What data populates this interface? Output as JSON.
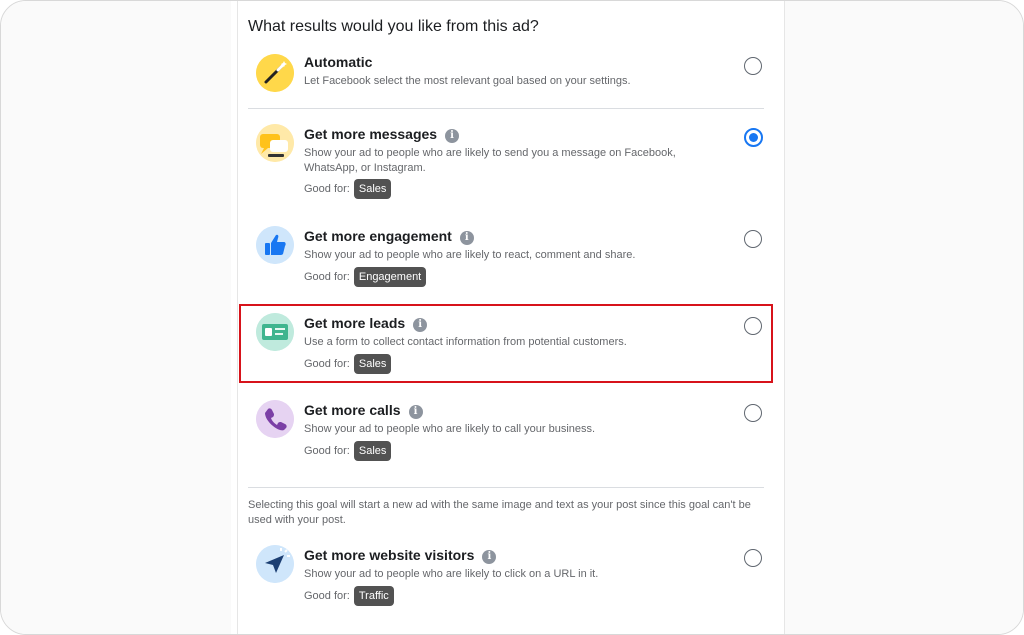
{
  "question": "What results would you like from this ad?",
  "options": [
    {
      "title": "Automatic",
      "description": "Let Facebook select the most relevant goal based on your settings.",
      "good_for_label": "",
      "chip": "",
      "selected": false,
      "icon": "magic-wand-icon"
    },
    {
      "title": "Get more messages",
      "description": "Show your ad to people who are likely to send you a message on Facebook, WhatsApp, or Instagram.",
      "good_for_label": "Good for:",
      "chip": "Sales",
      "selected": true,
      "icon": "chat-bubble-icon"
    },
    {
      "title": "Get more engagement",
      "description": "Show your ad to people who are likely to react, comment and share.",
      "good_for_label": "Good for:",
      "chip": "Engagement",
      "selected": false,
      "icon": "thumbs-up-icon"
    },
    {
      "title": "Get more leads",
      "description": "Use a form to collect contact information from potential customers.",
      "good_for_label": "Good for:",
      "chip": "Sales",
      "selected": false,
      "icon": "lead-card-icon"
    },
    {
      "title": "Get more calls",
      "description": "Show your ad to people who are likely to call your business.",
      "good_for_label": "Good for:",
      "chip": "Sales",
      "selected": false,
      "icon": "phone-icon"
    },
    {
      "title": "Get more website visitors",
      "description": "Show your ad to people who are likely to click on a URL in it.",
      "good_for_label": "Good for:",
      "chip": "Traffic",
      "selected": false,
      "icon": "cursor-arrow-icon"
    }
  ],
  "note": "Selecting this goal will start a new ad with the same image and text as your post since this goal can't be used with your post.",
  "info_glyph": "i",
  "colors": {
    "accent": "#1877f2",
    "highlight": "#d7131b",
    "chip": "#525252"
  }
}
